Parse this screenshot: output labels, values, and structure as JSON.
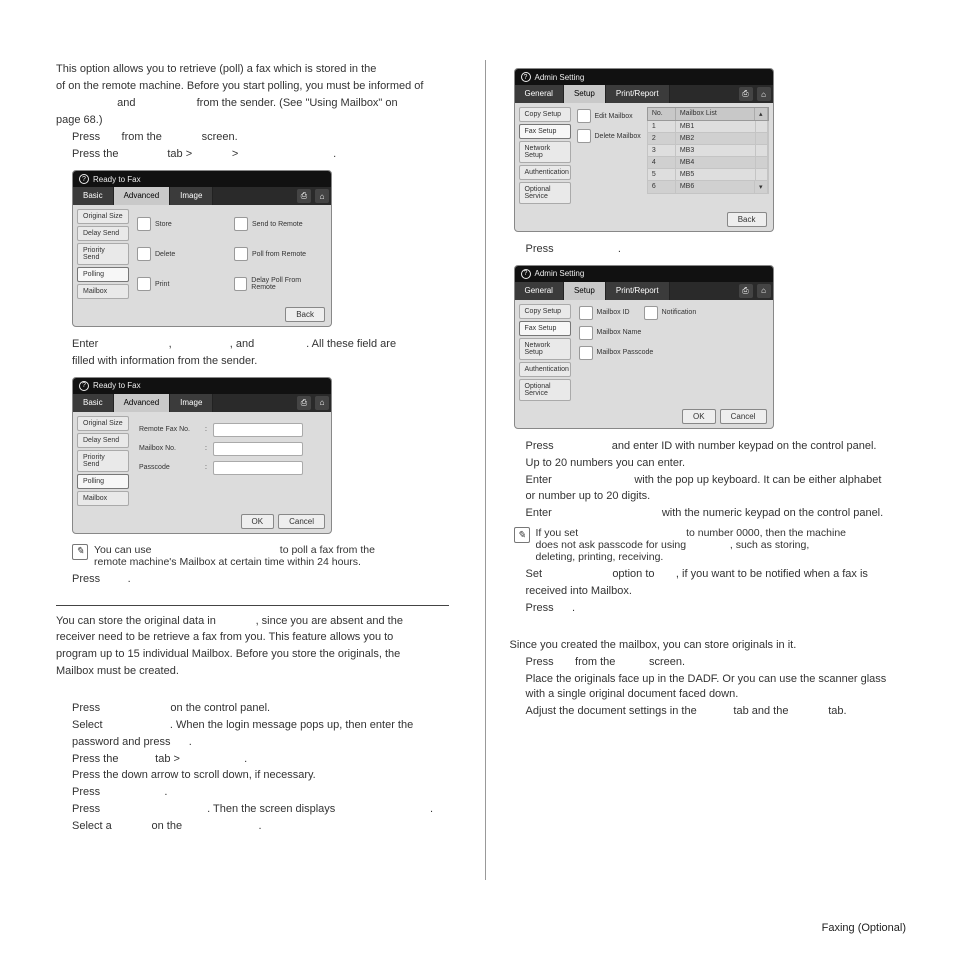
{
  "footer": {
    "section": "Faxing (Optional)"
  },
  "left": {
    "p1": "This option allows you to retrieve (poll) a fax which is stored in the",
    "p2": "of on the remote machine. Before you start polling, you must be informed of",
    "p3a": "and",
    "p3b": "from the sender. (See \"Using Mailbox\" on",
    "p4": "page 68.)",
    "s1a": "Press",
    "s1b": "from the",
    "s1c": "screen.",
    "s2a": "Press the",
    "s2b": "tab >",
    "s2c": ">",
    "s2d": ".",
    "s3a": "Enter",
    "s3b": ",",
    "s3c": ", and",
    "s3d": ". All these field are",
    "s3e": "filled with information from the sender.",
    "note1a": "You can use",
    "note1b": "to poll a fax from the",
    "note1c": "remote machine's Mailbox at certain time within 24 hours.",
    "s4a": "Press",
    "s4b": ".",
    "mb1a": "You can store the original data in",
    "mb1b": ", since you are absent and the",
    "mb2": "receiver need to be retrieve a fax from you. This feature allows you to",
    "mb3": "program up to 15 individual Mailbox. Before you store the originals, the",
    "mb4": "Mailbox must be created.",
    "c1a": "Press",
    "c1b": "on the control panel.",
    "c2a": "Select",
    "c2b": ". When the login message pops up, then enter the",
    "c2c": "password and press",
    "c2d": ".",
    "c3a": "Press the",
    "c3b": "tab >",
    "c3c": ".",
    "c4": "Press the down arrow to scroll down, if necessary.",
    "c5a": "Press",
    "c5b": ".",
    "c6a": "Press",
    "c6b": ". Then the screen displays",
    "c6c": ".",
    "c7a": "Select a",
    "c7b": "on the",
    "c7c": "."
  },
  "right": {
    "r1a": "Press",
    "r1b": ".",
    "r2a": "Press",
    "r2b": "and enter ID with number keypad on the control panel.",
    "r2c": "Up to 20 numbers you can enter.",
    "r3a": "Enter",
    "r3b": "with the pop up keyboard. It can be either alphabet",
    "r3c": "or number up to 20 digits.",
    "r4a": "Enter",
    "r4b": "with the numeric keypad on the control panel.",
    "note2a": "If you set",
    "note2b": "to number 0000, then the machine",
    "note2c": "does not ask passcode for using",
    "note2d": ", such as storing,",
    "note2e": "deleting, printing, receiving.",
    "r5a": "Set",
    "r5b": "option to",
    "r5c": ", if you want to be notified when a fax is",
    "r5d": "received into Mailbox.",
    "r6a": "Press",
    "r6b": ".",
    "so1": "Since you created the mailbox, you can store originals in it.",
    "so2a": "Press",
    "so2b": "from the",
    "so2c": "screen.",
    "so3": "Place the originals face up in the DADF. Or you can use the scanner glass with a single original document faced down.",
    "so4a": "Adjust the document settings in the",
    "so4b": "tab and the",
    "so4c": "tab."
  },
  "shot1": {
    "title": "Ready to Fax",
    "tabs": {
      "basic": "Basic",
      "adv": "Advanced",
      "img": "Image"
    },
    "side": {
      "orig": "Original Size",
      "delay": "Delay Send",
      "pri": "Priority Send",
      "poll": "Polling",
      "mail": "Mailbox"
    },
    "opts": {
      "store": "Store",
      "send": "Send to Remote",
      "del": "Delete",
      "pfr": "Poll from Remote",
      "prt": "Print",
      "dpfr": "Delay Poll From Remote"
    },
    "back": "Back"
  },
  "shot2": {
    "f1": "Remote Fax No.",
    "f2": "Mailbox No.",
    "f3": "Passcode",
    "ok": "OK",
    "cancel": "Cancel"
  },
  "shot3": {
    "title": "Admin Setting",
    "tabs": {
      "gen": "General",
      "setup": "Setup",
      "pr": "Print/Report"
    },
    "side": {
      "copy": "Copy Setup",
      "fax": "Fax Setup",
      "net": "Network Setup",
      "auth": "Authentication",
      "opt": "Optional Service"
    },
    "ops": {
      "edit": "Edit Mailbox",
      "del": "Delete Mailbox"
    },
    "thNo": "No.",
    "thList": "Mailbox List",
    "rows": [
      "MB1",
      "MB2",
      "MB3",
      "MB4",
      "MB5",
      "MB6"
    ],
    "back": "Back"
  },
  "shot4": {
    "f1": "Mailbox ID",
    "f2": "Notification",
    "f3": "Mailbox Name",
    "f4": "Mailbox Passcode",
    "ok": "OK",
    "cancel": "Cancel"
  }
}
